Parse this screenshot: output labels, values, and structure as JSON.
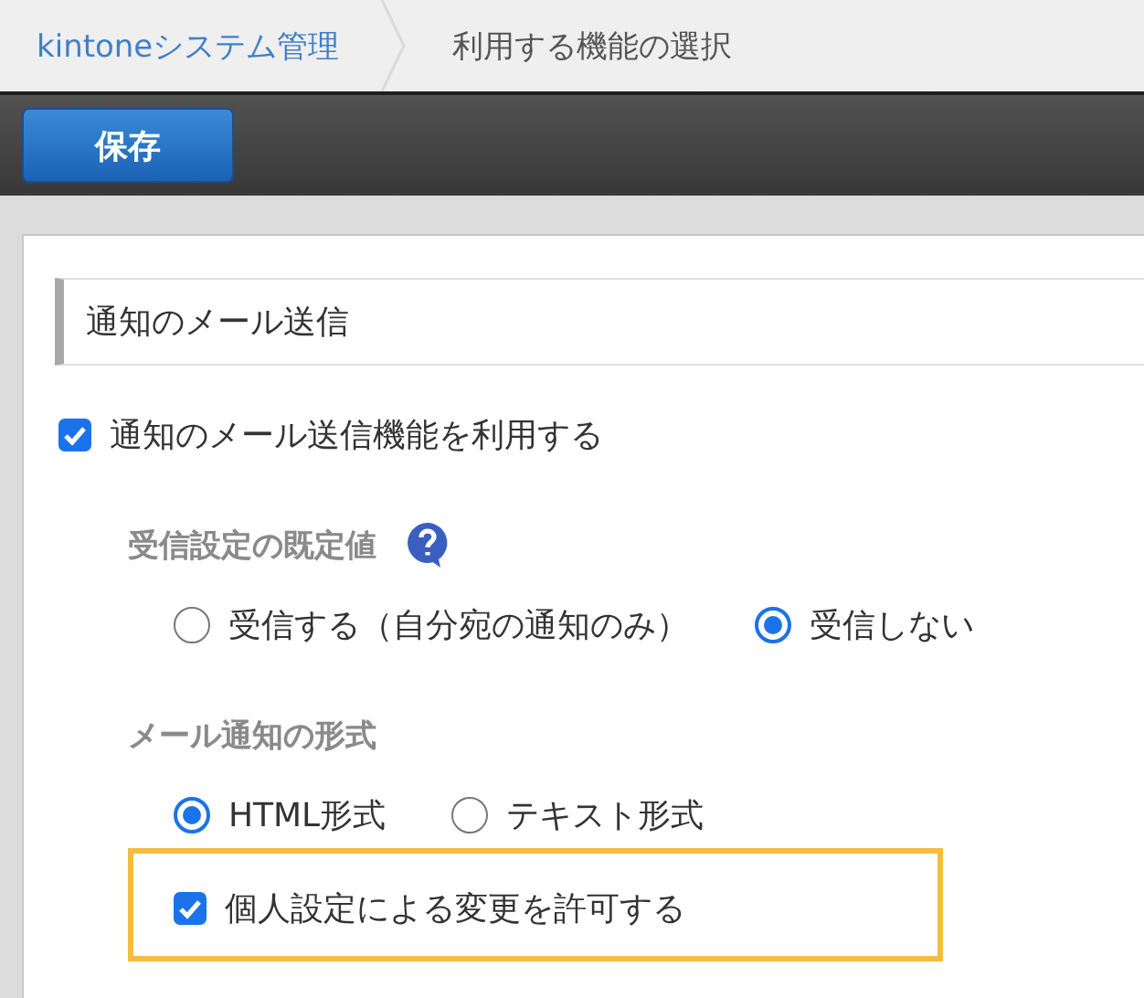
{
  "breadcrumb": [
    {
      "label": "kintoneシステム管理",
      "kind": "link"
    },
    {
      "label": "利用する機能の選択",
      "kind": "current"
    }
  ],
  "toolbar": {
    "save_button": "保存"
  },
  "section": {
    "title": "通知のメール送信",
    "main_option": {
      "label": "通知のメール送信機能を利用する",
      "checked": true
    },
    "groups": [
      {
        "label": "受信設定の既定値",
        "help": true,
        "options": [
          {
            "label": "受信する（自分宛の通知のみ）",
            "selected": false
          },
          {
            "label": "受信しない",
            "selected": true
          }
        ]
      },
      {
        "label": "メール通知の形式",
        "options": [
          {
            "label": "HTML形式",
            "selected": true
          },
          {
            "label": "テキスト形式",
            "selected": false
          }
        ],
        "extra": {
          "label": "個人設定による変更を許可する",
          "checked": true,
          "highlighted": true
        }
      }
    ]
  }
}
